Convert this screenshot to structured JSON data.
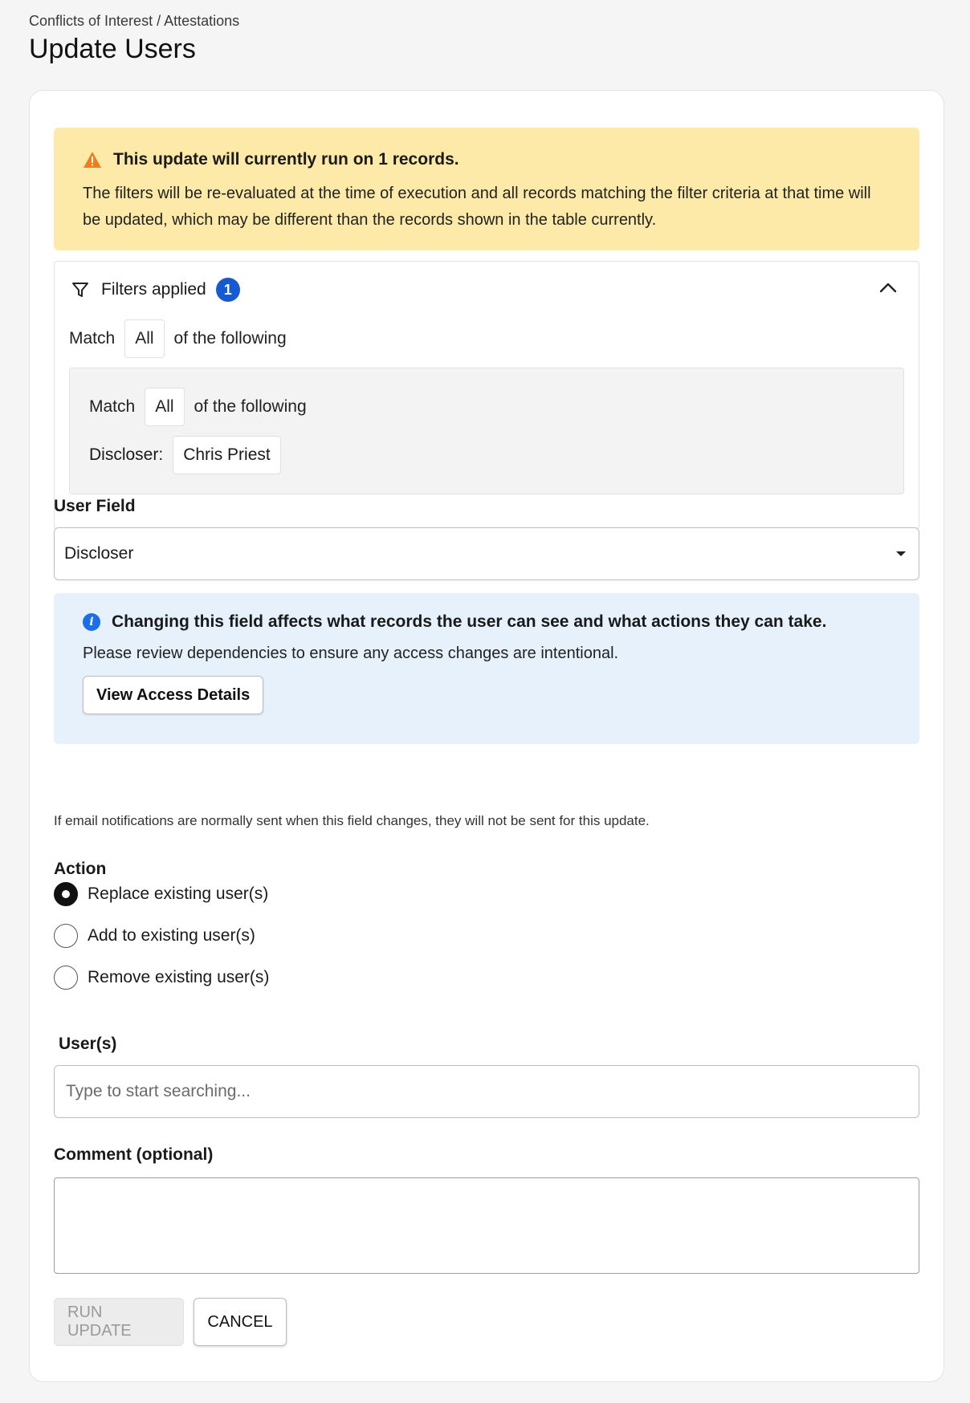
{
  "header": {
    "breadcrumb": "Conflicts of Interest / Attestations",
    "title": "Update Users"
  },
  "warning": {
    "title": "This update will currently run on 1 records.",
    "body": "The filters will be re-evaluated at the time of execution and all records matching the filter criteria at that time will be updated, which may be different than the records shown in the table currently."
  },
  "filters": {
    "label": "Filters applied",
    "count": "1",
    "outer": {
      "match": "Match",
      "mode": "All",
      "suffix": "of the following"
    },
    "inner": {
      "match": "Match",
      "mode": "All",
      "suffix": "of the following",
      "field_label": "Discloser:",
      "field_value": "Chris Priest"
    }
  },
  "user_field": {
    "label": "User Field",
    "value": "Discloser"
  },
  "info": {
    "title": "Changing this field affects what records the user can see and what actions they can take.",
    "body": "Please review dependencies to ensure any access changes are intentional.",
    "button": "View Access Details"
  },
  "email_note": "If email notifications are normally sent when this field changes, they will not be sent for this update.",
  "action": {
    "label": "Action",
    "options": [
      {
        "label": "Replace existing user(s)",
        "checked": true
      },
      {
        "label": "Add to existing user(s)",
        "checked": false
      },
      {
        "label": "Remove existing user(s)",
        "checked": false
      }
    ]
  },
  "users": {
    "label": "User(s)",
    "placeholder": "Type to start searching..."
  },
  "comment": {
    "label": "Comment (optional)"
  },
  "buttons": {
    "run": "RUN UPDATE",
    "cancel": "CANCEL"
  },
  "colors": {
    "warning_bg": "#fdeaa8",
    "warning_icon": "#f07c1a",
    "info_bg": "#e6f1fc",
    "info_icon": "#1a6fe8",
    "badge": "#1759d1"
  }
}
